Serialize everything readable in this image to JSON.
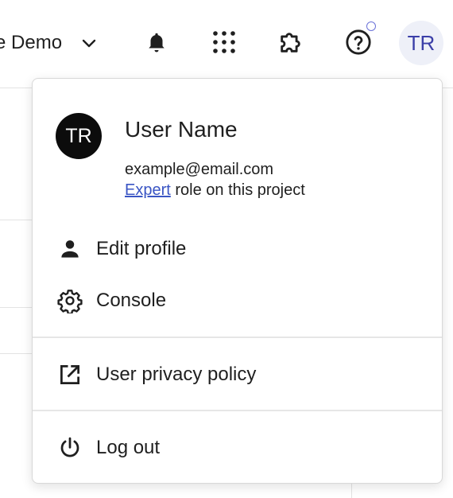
{
  "header": {
    "project_name": "e Demo",
    "avatar_initials": "TR",
    "icons": [
      "chevron-down-icon",
      "bell-icon",
      "apps-grid-icon",
      "extension-icon",
      "help-icon"
    ]
  },
  "menu": {
    "avatar_initials": "TR",
    "user_name": "User Name",
    "email": "example@email.com",
    "role_link": "Expert",
    "role_suffix": " role on this project",
    "items": [
      {
        "label": "Edit profile",
        "icon": "person-icon"
      },
      {
        "label": "Console",
        "icon": "gear-icon"
      },
      {
        "label": "User privacy policy",
        "icon": "external-link-icon"
      },
      {
        "label": "Log out",
        "icon": "power-icon"
      }
    ]
  },
  "colors": {
    "link": "#3a55c4",
    "avatar_top_bg": "#eef0f8",
    "avatar_top_text": "#3b3fa8",
    "menu_avatar_bg": "#0c0c0c"
  }
}
